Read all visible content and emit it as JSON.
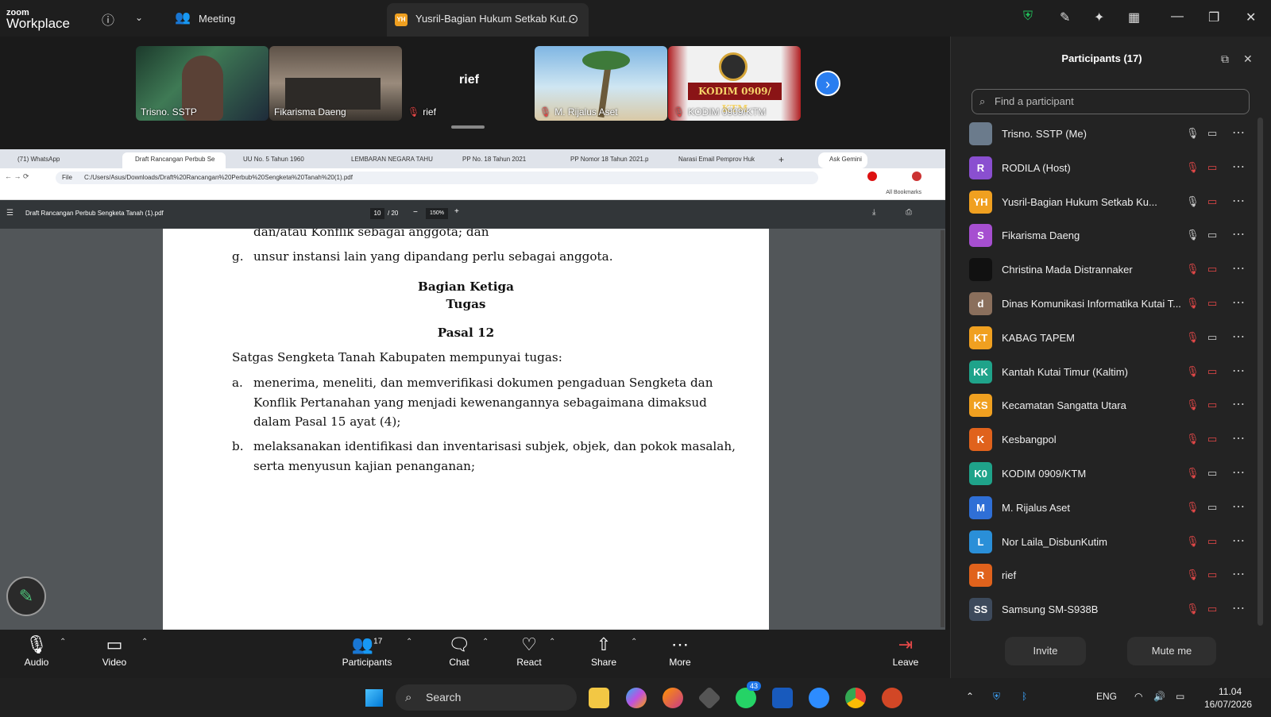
{
  "app": {
    "brand_small": "zoom",
    "brand_big": "Workplace",
    "meeting_label": "Meeting",
    "active_tab_badge": "YH",
    "active_tab_title": "Yusril-Bagian Hukum Setkab Kut.."
  },
  "video_strip": {
    "tiles": [
      {
        "name": "Trisno. SSTP",
        "muted": false
      },
      {
        "name": "Fikarisma Daeng",
        "muted": false
      },
      {
        "name": "rief",
        "muted": true,
        "big_label": "rief"
      },
      {
        "name": "M. Rijalus Aset",
        "muted": true
      },
      {
        "name": "KODIM 0909/KTM",
        "muted": true,
        "banner": "KODIM 0909/ KTM"
      }
    ],
    "next_icon": "chevron-right-icon"
  },
  "browser": {
    "tabs": [
      "(71) WhatsApp",
      "Draft Rancangan Perbub Se",
      "UU No. 5 Tahun 1960",
      "LEMBARAN NEGARA TAHU",
      "PP No. 18 Tahun 2021",
      "PP Nomor 18 Tahun 2021.p",
      "Narasi Email Pemprov Huk"
    ],
    "ask_gemini": "Ask Gemini",
    "url_scheme": "File",
    "url": "C:/Users/Asus/Downloads/Draft%20Rancangan%20Perbub%20Sengketa%20Tanah%20(1).pdf",
    "all_bookmarks": "All Bookmarks"
  },
  "pdf": {
    "filename": "Draft Rancangan Perbub Sengketa Tanah (1).pdf",
    "page_current": "10",
    "page_total": "/ 20",
    "zoom": "150%",
    "lines": {
      "top_partial": "dan/atau Konflik sebagai anggota; dan",
      "item_g_marker": "g.",
      "item_g": "unsur instansi lain yang dipandang perlu sebagai anggota.",
      "section": "Bagian Ketiga",
      "section_sub": "Tugas",
      "article": "Pasal 12",
      "intro": "Satgas Sengketa Tanah Kabupaten mempunyai tugas:",
      "a_marker": "a.",
      "a1": "menerima, meneliti, dan memverifikasi dokumen pengaduan Sengketa dan",
      "a2": "Konflik Pertanahan yang menjadi kewenangannya sebagaimana dimaksud",
      "a3": "dalam Pasal 15 ayat (4);",
      "b_marker": "b.",
      "b1": "melaksanakan identifikasi dan inventarisasi subjek, objek, dan pokok masalah,",
      "b2": "serta menyusun kajian penanganan;"
    }
  },
  "participants": {
    "title": "Participants (17)",
    "search_placeholder": "Find a participant",
    "list": [
      {
        "initials": "",
        "name": "Trisno. SSTP (Me)",
        "color": "#6b7b8c",
        "mic": "on",
        "cam": "on"
      },
      {
        "initials": "R",
        "name": "RODILA (Host)",
        "color": "#8a4fd0",
        "mic": "off",
        "cam": "off"
      },
      {
        "initials": "YH",
        "name": "Yusril-Bagian Hukum Setkab Ku...",
        "color": "#f0a020",
        "mic": "on",
        "cam": "off"
      },
      {
        "initials": "S",
        "name": "Fikarisma Daeng",
        "color": "#a64fd0",
        "mic": "on",
        "cam": "on"
      },
      {
        "initials": "",
        "name": "Christina Mada Distrannaker",
        "color": "#111111",
        "mic": "off",
        "cam": "off"
      },
      {
        "initials": "d",
        "name": "Dinas Komunikasi Informatika Kutai T...",
        "color": "#8a6f5c",
        "mic": "off",
        "cam": "off"
      },
      {
        "initials": "KT",
        "name": "KABAG TAPEM",
        "color": "#f0a020",
        "mic": "off",
        "cam": "on"
      },
      {
        "initials": "KK",
        "name": "Kantah Kutai Timur (Kaltim)",
        "color": "#1fa38a",
        "mic": "off",
        "cam": "off"
      },
      {
        "initials": "KS",
        "name": "Kecamatan Sangatta Utara",
        "color": "#f0a020",
        "mic": "off",
        "cam": "off"
      },
      {
        "initials": "K",
        "name": "Kesbangpol",
        "color": "#e0621c",
        "mic": "off",
        "cam": "off"
      },
      {
        "initials": "K0",
        "name": "KODIM 0909/KTM",
        "color": "#1fa38a",
        "mic": "off",
        "cam": "on"
      },
      {
        "initials": "M",
        "name": "M. Rijalus Aset",
        "color": "#2f6fd6",
        "mic": "off",
        "cam": "on"
      },
      {
        "initials": "L",
        "name": "Nor Laila_DisbunKutim",
        "color": "#2a8fd8",
        "mic": "off",
        "cam": "off"
      },
      {
        "initials": "R",
        "name": "rief",
        "color": "#e0621c",
        "mic": "off",
        "cam": "off"
      },
      {
        "initials": "SS",
        "name": "Samsung SM-S938B",
        "color": "#3d4a5c",
        "mic": "off",
        "cam": "off"
      }
    ],
    "invite_label": "Invite",
    "mute_label": "Mute me"
  },
  "toolbar": {
    "audio": "Audio",
    "video": "Video",
    "participants": "Participants",
    "participants_count": "17",
    "chat": "Chat",
    "react": "React",
    "share": "Share",
    "more": "More",
    "leave": "Leave"
  },
  "taskbar": {
    "search": "Search",
    "whatsapp_badge": "43",
    "lang": "ENG",
    "time": "11.04",
    "date": "16/07/2026"
  }
}
